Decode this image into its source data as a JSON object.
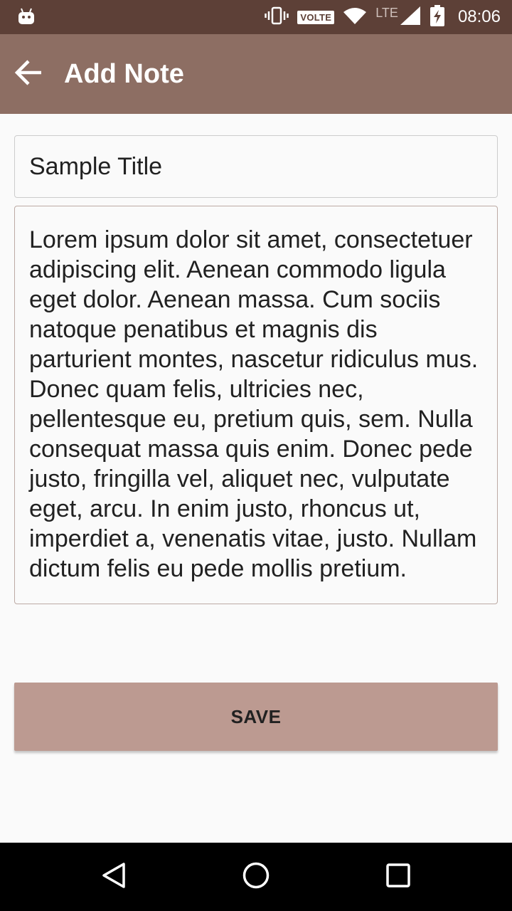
{
  "status_bar": {
    "time": "08:06",
    "volte_label": "VOLTE",
    "network_label": "LTE",
    "icons": [
      "android-icon",
      "vibrate-icon",
      "volte-icon",
      "wifi-icon",
      "lte-signal-icon",
      "battery-charging-icon"
    ]
  },
  "app_bar": {
    "title": "Add Note",
    "back_icon": "arrow-back-icon",
    "background_color": "#8d6e63"
  },
  "form": {
    "title_value": "Sample Title",
    "body_value": "Lorem ipsum dolor sit amet, consectetuer adipiscing elit. Aenean commodo ligula eget dolor. Aenean massa. Cum sociis natoque penatibus et magnis dis parturient montes, nascetur ridiculus mus. Donec quam felis, ultricies nec, pellentesque eu, pretium quis, sem. Nulla consequat massa quis enim. Donec pede justo, fringilla vel, aliquet nec, vulputate eget, arcu. In enim justo, rhoncus ut, imperdiet a, venenatis vitae, justo. Nullam dictum felis eu pede mollis pretium.",
    "save_label": "SAVE",
    "save_color": "#bc9a91"
  },
  "nav_bar": {
    "icons": [
      "back-triangle-icon",
      "home-circle-icon",
      "recents-square-icon"
    ]
  }
}
